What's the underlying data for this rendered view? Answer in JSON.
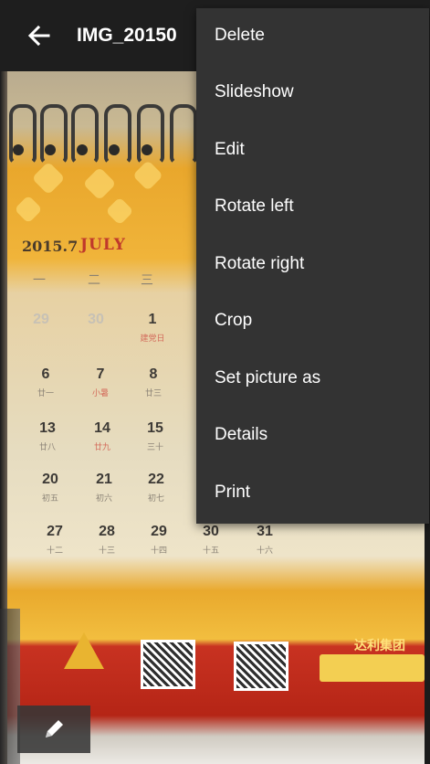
{
  "app_bar": {
    "title": "IMG_20150",
    "back_icon": "arrow-back-icon"
  },
  "overflow_menu": {
    "items": [
      {
        "label": "Delete"
      },
      {
        "label": "Slideshow"
      },
      {
        "label": "Edit"
      },
      {
        "label": "Rotate left"
      },
      {
        "label": "Rotate right"
      },
      {
        "label": "Crop"
      },
      {
        "label": "Set picture as"
      },
      {
        "label": "Details"
      },
      {
        "label": "Print"
      }
    ]
  },
  "edit_button": {
    "icon": "pencil-icon"
  },
  "photo": {
    "calendar_year": "2015.7",
    "calendar_month": "JULY",
    "weekday_marks": [
      "一",
      "二",
      "三"
    ],
    "rows": [
      {
        "days": [
          "29",
          "30",
          "1"
        ],
        "lunar": [
          "",
          "",
          "建党日"
        ]
      },
      {
        "days": [
          "6",
          "7",
          "8"
        ],
        "lunar": [
          "廿一",
          "小暑",
          "廿三"
        ]
      },
      {
        "days": [
          "13",
          "14",
          "15"
        ],
        "lunar": [
          "廿八",
          "廿九",
          "三十"
        ]
      },
      {
        "days": [
          "20",
          "21",
          "22"
        ],
        "lunar": [
          "初五",
          "初六",
          "初七"
        ]
      },
      {
        "days": [
          "27",
          "28",
          "29",
          "30",
          "31"
        ],
        "lunar": [
          "十二",
          "十三",
          "十四",
          "十五",
          "十六"
        ]
      }
    ],
    "banner_title": "达利集团"
  },
  "colors": {
    "app_bar": "#1e1e1e",
    "menu_bg": "#333333",
    "menu_text": "#ffffff"
  }
}
